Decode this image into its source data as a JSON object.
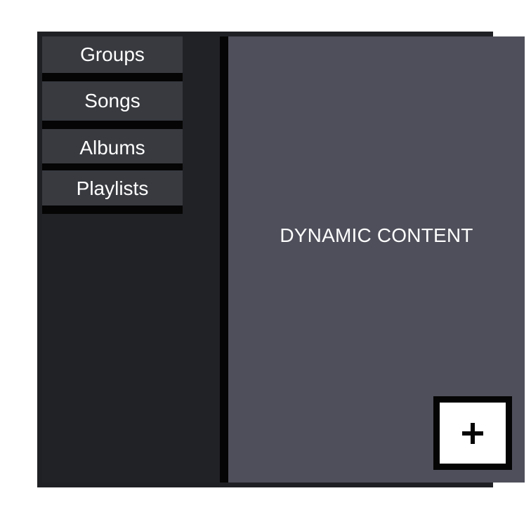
{
  "sidebar": {
    "items": [
      {
        "label": "Groups"
      },
      {
        "label": "Songs"
      },
      {
        "label": "Albums"
      },
      {
        "label": "Playlists"
      }
    ]
  },
  "content": {
    "placeholder_text": "DYNAMIC CONTENT"
  },
  "fab": {
    "icon": "plus-icon"
  },
  "colors": {
    "frame": "#1f2024",
    "sidebar_bg": "#212226",
    "nav_item_bg": "#383a40",
    "separator": "#050505",
    "content_bg": "#4e4f5a",
    "text": "#ffffff",
    "fab_bg": "#ffffff"
  }
}
